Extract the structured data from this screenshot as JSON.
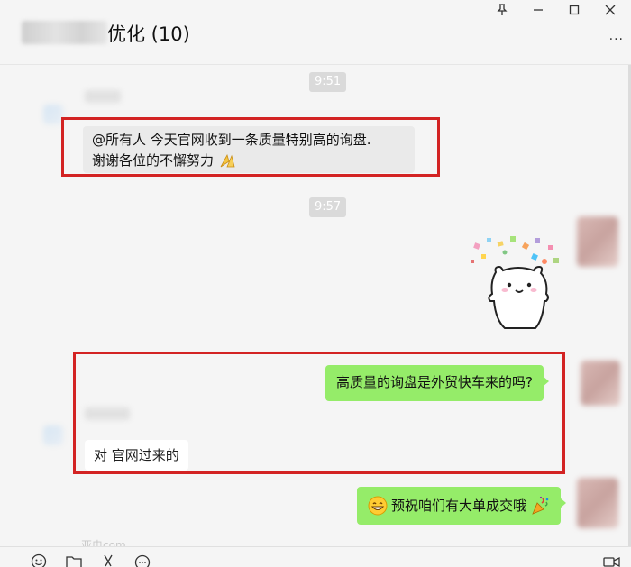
{
  "title": {
    "chat_name_suffix": "优化 (10)"
  },
  "window_controls": {
    "pin": "⊼",
    "minimize": "—",
    "maximize": "☐",
    "close": "✕",
    "more": "···"
  },
  "messages": [
    {
      "type": "time",
      "text": "9:51"
    },
    {
      "type": "incoming",
      "text_line1": "@所有人  今天官网收到一条质量特别高的询盘.",
      "text_line2": "谢谢各位的不懈努力",
      "trailing_icon": "praying-hands"
    },
    {
      "type": "time",
      "text": "9:57"
    },
    {
      "type": "outgoing-sticker",
      "icon": "bear-confetti-sticker"
    },
    {
      "type": "outgoing",
      "text": "高质量的询盘是外贸快车来的吗?"
    },
    {
      "type": "incoming",
      "text": "对 官网过来的"
    },
    {
      "type": "outgoing",
      "text": "预祝咱们有大单成交哦",
      "leading_icon": "grinning-face",
      "trailing_icon": "party-popper"
    }
  ],
  "watermark": "亚电com",
  "toolbar": {
    "icons": [
      "smiley-icon",
      "folder-icon",
      "scissors-icon",
      "chat-icon",
      "video-icon"
    ]
  },
  "colors": {
    "accent_green": "#95ec69",
    "highlight_red": "#d32323",
    "background": "#f5f5f5"
  }
}
